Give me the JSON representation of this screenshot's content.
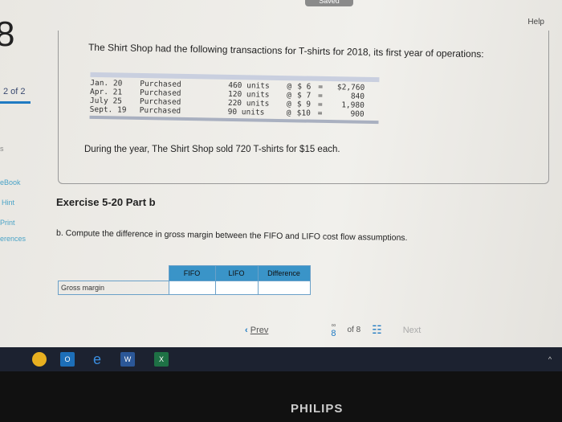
{
  "header": {
    "saved": "Saved",
    "help": "Help"
  },
  "question": {
    "number": "8",
    "pager": "2 of 2"
  },
  "sidebar": {
    "items": [
      {
        "label": "s"
      },
      {
        "label": "eBook"
      },
      {
        "label": "Hint"
      },
      {
        "label": "Print"
      },
      {
        "label": "erences"
      }
    ]
  },
  "problem": {
    "intro": "The Shirt Shop had the following transactions for T-shirts for 2018, its first year of operations:",
    "rows": [
      {
        "date": "Jan. 20",
        "action": "Purchased",
        "units": "460 units",
        "at": "@",
        "price": "$ 6",
        "eq": "=",
        "total": "$2,760"
      },
      {
        "date": "Apr. 21",
        "action": "Purchased",
        "units": "120 units",
        "at": "@",
        "price": "$ 7",
        "eq": "=",
        "total": "840"
      },
      {
        "date": "July 25",
        "action": "Purchased",
        "units": "220 units",
        "at": "@",
        "price": "$ 9",
        "eq": "=",
        "total": "1,980"
      },
      {
        "date": "Sept. 19",
        "action": "Purchased",
        "units": "90 units",
        "at": "@",
        "price": "$10",
        "eq": "=",
        "total": "900"
      }
    ],
    "sold": "During the year, The Shirt Shop sold 720 T-shirts for $15 each."
  },
  "exercise": {
    "title": "Exercise 5-20 Part b",
    "question": "b. Compute the difference in gross margin between the FIFO and LIFO cost flow assumptions.",
    "table": {
      "headers": [
        "",
        "FIFO",
        "LIFO",
        "Difference"
      ],
      "row_label": "Gross margin",
      "values": [
        "",
        "",
        ""
      ]
    }
  },
  "nav": {
    "prev": "Prev",
    "current": "8",
    "of": "of 8",
    "next": "Next"
  },
  "taskbar": {
    "apps": [
      "chrome-icon",
      "outlook-icon",
      "edge-icon",
      "word-icon",
      "excel-icon"
    ]
  },
  "monitor": {
    "brand": "PHILIPS"
  }
}
